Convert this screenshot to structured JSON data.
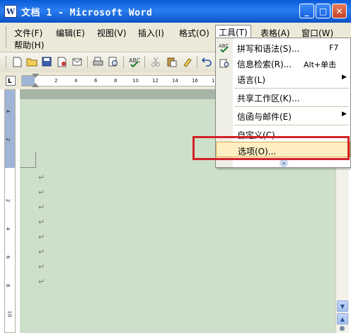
{
  "window": {
    "title": "文档 1 - Microsoft Word",
    "app_icon": "W",
    "controls": {
      "minimize": "_",
      "maximize": "□",
      "close": "✕"
    }
  },
  "menubar": {
    "items": [
      "文件(F)",
      "编辑(E)",
      "视图(V)",
      "插入(I)",
      "格式(O)",
      "工具(T)",
      "表格(A)",
      "窗口(W)",
      "帮助(H)"
    ],
    "active_item": "工具(T)"
  },
  "toolbar": {
    "icons": [
      "new-icon",
      "open-icon",
      "save-icon",
      "permission-icon",
      "email-icon",
      "print-icon",
      "print-preview-icon",
      "spelling-icon",
      "cut-icon",
      "paste-icon",
      "format-painter-icon",
      "undo-icon"
    ]
  },
  "ruler": {
    "tab_selector": "L",
    "h_ticks": [
      "2",
      "4",
      "6",
      "8",
      "10",
      "12",
      "14",
      "16",
      "1"
    ],
    "v_ticks": [
      "4",
      "2",
      "2",
      "4",
      "6",
      "8",
      "10"
    ]
  },
  "tools_menu": {
    "items": [
      {
        "label": "拼写和语法(S)...",
        "shortcut": "F7",
        "icon": "spelling-icon",
        "submenu": false
      },
      {
        "label": "信息检索(R)...",
        "shortcut": "Alt+单击",
        "icon": "research-icon",
        "submenu": false
      },
      {
        "label": "语言(L)",
        "shortcut": "",
        "icon": "",
        "submenu": true
      },
      {
        "label": "共享工作区(K)...",
        "shortcut": "",
        "icon": "",
        "submenu": false
      },
      {
        "label": "信函与邮件(E)",
        "shortcut": "",
        "icon": "",
        "submenu": true
      },
      {
        "label": "自定义(C)...",
        "shortcut": "",
        "icon": "",
        "submenu": false
      },
      {
        "label": "选项(O)...",
        "shortcut": "",
        "icon": "",
        "submenu": false,
        "highlighted": true
      }
    ],
    "expand_glyph": "»"
  },
  "document": {
    "paragraph_mark": "↵",
    "paragraph_count": 8
  },
  "scrollbar": {
    "down_arrow": "▼",
    "up_arrow": "▲"
  },
  "colors": {
    "titlebar": "#0a5bd8",
    "document_background": "#cde0c9",
    "menu_highlight": "#ffeec2",
    "annotation_box": "#d2232a"
  }
}
